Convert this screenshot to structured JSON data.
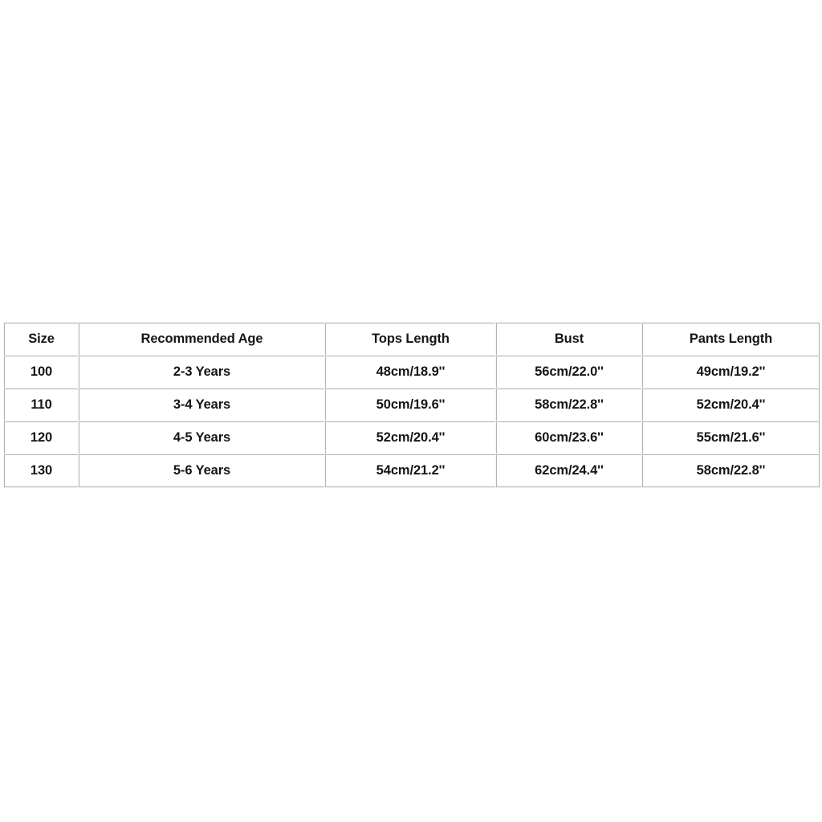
{
  "page": {
    "background_color": "#ffffff",
    "table_border_color": "#9a9a9a",
    "cell_border_color": "#b4b4b4",
    "text_color": "#151515"
  },
  "size_chart": {
    "name": "size-chart",
    "columns": [
      {
        "key": "size",
        "label": "Size"
      },
      {
        "key": "age",
        "label": "Recommended Age"
      },
      {
        "key": "tops",
        "label": "Tops Length"
      },
      {
        "key": "bust",
        "label": "Bust"
      },
      {
        "key": "pants",
        "label": "Pants Length"
      }
    ],
    "rows": [
      {
        "size": "100",
        "age": "2-3 Years",
        "tops": "48cm/18.9''",
        "bust": "56cm/22.0''",
        "pants": "49cm/19.2''"
      },
      {
        "size": "110",
        "age": "3-4 Years",
        "tops": "50cm/19.6''",
        "bust": "58cm/22.8''",
        "pants": "52cm/20.4''"
      },
      {
        "size": "120",
        "age": "4-5 Years",
        "tops": "52cm/20.4''",
        "bust": "60cm/23.6''",
        "pants": "55cm/21.6''"
      },
      {
        "size": "130",
        "age": "5-6 Years",
        "tops": "54cm/21.2''",
        "bust": "62cm/24.4''",
        "pants": "58cm/22.8''"
      }
    ]
  }
}
